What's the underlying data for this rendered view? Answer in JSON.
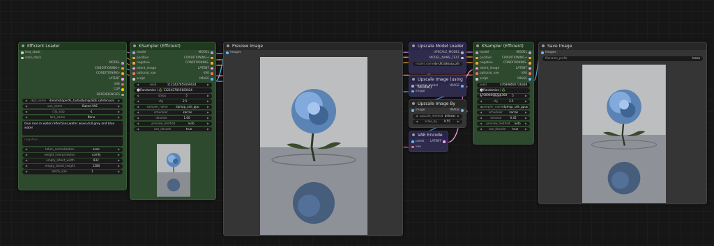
{
  "colors": {
    "model": "#b39ddb",
    "conditioning": "#ffa931",
    "latent": "#ff9cf9",
    "vae": "#ff6e6e",
    "clip": "#ffd500",
    "image": "#64b5f6",
    "pipe": "#7fbf7f",
    "upscale_model": "#b0b0b0",
    "generic": "#cccccc"
  },
  "efficient_loader": {
    "title": "Efficient Loader",
    "inputs": [
      {
        "label": "lora_stack",
        "type": "generic"
      },
      {
        "label": "cnet_stack",
        "type": "generic"
      }
    ],
    "outputs": [
      {
        "label": "MODEL",
        "type": "model"
      },
      {
        "label": "CONDITIONING+",
        "type": "conditioning"
      },
      {
        "label": "CONDITIONING-",
        "type": "conditioning"
      },
      {
        "label": "LATENT",
        "type": "latent"
      },
      {
        "label": "VAE",
        "type": "vae"
      },
      {
        "label": "CLIP",
        "type": "clip"
      },
      {
        "label": "DEPENDENCIES",
        "type": "pipe"
      }
    ],
    "widgets": [
      {
        "name": "ckpt_name",
        "value": "dreamshaperXL_turboDpmppSDE.safetensors"
      },
      {
        "name": "vae_name",
        "value": "Baked VAE"
      },
      {
        "name": "clip_skip",
        "value": "-1"
      },
      {
        "name": "lora_name",
        "value": "None"
      }
    ],
    "positive_prompt": "blue rose in water,reflections,water wave,dull,grey and blue water",
    "negative_placeholder": "negative",
    "widgets2": [
      {
        "name": "token_normalization",
        "value": "none"
      },
      {
        "name": "weight_interpretation",
        "value": "comfy"
      },
      {
        "name": "empty_latent_width",
        "value": "832"
      },
      {
        "name": "empty_latent_height",
        "value": "1280"
      },
      {
        "name": "batch_size",
        "value": "1"
      }
    ]
  },
  "ksampler1": {
    "title": "KSampler (Efficient)",
    "slots": [
      {
        "in": "model",
        "in_type": "model",
        "out": "MODEL",
        "out_type": "model"
      },
      {
        "in": "positive",
        "in_type": "conditioning",
        "out": "CONDITIONING+",
        "out_type": "conditioning"
      },
      {
        "in": "negative",
        "in_type": "conditioning",
        "out": "CONDITIONING-",
        "out_type": "conditioning"
      },
      {
        "in": "latent_image",
        "in_type": "latent",
        "out": "LATENT",
        "out_type": "latent"
      },
      {
        "in": "optional_vae",
        "in_type": "vae",
        "out": "VAE",
        "out_type": "vae"
      },
      {
        "in": "script",
        "in_type": "generic",
        "out": "IMAGE",
        "out_type": "image"
      }
    ],
    "seed": {
      "name": "seed",
      "value": "1122427859169024"
    },
    "randomize": "🎲Randomize / ♻️ 1122427859169024",
    "widgets": [
      {
        "name": "steps",
        "value": "5"
      },
      {
        "name": "cfg",
        "value": "2.5"
      },
      {
        "name": "sampler_name",
        "value": "dpmpp_sde_gpu"
      },
      {
        "name": "scheduler",
        "value": "karras"
      },
      {
        "name": "denoise",
        "value": "1.00"
      },
      {
        "name": "preview_method",
        "value": "auto"
      },
      {
        "name": "vae_decode",
        "value": "true"
      }
    ]
  },
  "preview": {
    "title": "Preview Image",
    "input": "images"
  },
  "upscale_loader": {
    "title": "Upscale Model Loader",
    "outputs": [
      {
        "label": "UPSCALE_MODEL",
        "type": "upscale_model"
      },
      {
        "label": "MODEL_NAME_TEXT",
        "type": "generic"
      }
    ],
    "widget": {
      "name": "model_name",
      "value": "4x-UltraSharp.pth"
    }
  },
  "upscale_model": {
    "title": "Upscale Image (using Model)",
    "inputs": [
      {
        "label": "upscale_model",
        "type": "upscale_model"
      },
      {
        "label": "image",
        "type": "image"
      }
    ],
    "output": {
      "label": "IMAGE",
      "type": "image"
    }
  },
  "upscale_by": {
    "title": "Upscale Image By",
    "input": {
      "label": "image",
      "type": "image"
    },
    "output": {
      "label": "IMAGE",
      "type": "image"
    },
    "widgets": [
      {
        "name": "upscale_method",
        "value": "bilinear"
      },
      {
        "name": "scale_by",
        "value": "0.55"
      }
    ]
  },
  "vae_encode": {
    "title": "VAE Encode",
    "inputs": [
      {
        "label": "pixels",
        "type": "image"
      },
      {
        "label": "vae",
        "type": "vae"
      }
    ],
    "output": {
      "label": "LATENT",
      "type": "latent"
    }
  },
  "ksampler2": {
    "title": "KSampler (Efficient)",
    "slots": [
      {
        "in": "model",
        "in_type": "model",
        "out": "MODEL",
        "out_type": "model"
      },
      {
        "in": "positive",
        "in_type": "conditioning",
        "out": "CONDITIONING+",
        "out_type": "conditioning"
      },
      {
        "in": "negative",
        "in_type": "conditioning",
        "out": "CONDITIONING-",
        "out_type": "conditioning"
      },
      {
        "in": "latent_image",
        "in_type": "latent",
        "out": "LATENT",
        "out_type": "latent"
      },
      {
        "in": "optional_vae",
        "in_type": "vae",
        "out": "VAE",
        "out_type": "vae"
      },
      {
        "in": "script",
        "in_type": "generic",
        "out": "IMAGE",
        "out_type": "image"
      }
    ],
    "seed": {
      "name": "seed",
      "value": "476898695726368"
    },
    "randomize": "🎲Randomize / ♻️ 476898695726368",
    "widgets": [
      {
        "name": "steps",
        "value": "5"
      },
      {
        "name": "cfg",
        "value": "2.5"
      },
      {
        "name": "sampler_name",
        "value": "dpmpp_sde_gpu"
      },
      {
        "name": "scheduler",
        "value": "karras"
      },
      {
        "name": "denoise",
        "value": "0.45"
      },
      {
        "name": "preview_method",
        "value": "auto"
      },
      {
        "name": "vae_decode",
        "value": "true"
      }
    ]
  },
  "save": {
    "title": "Save Image",
    "input": "images",
    "widget": {
      "name": "filename_prefix",
      "value": "kmes"
    }
  }
}
